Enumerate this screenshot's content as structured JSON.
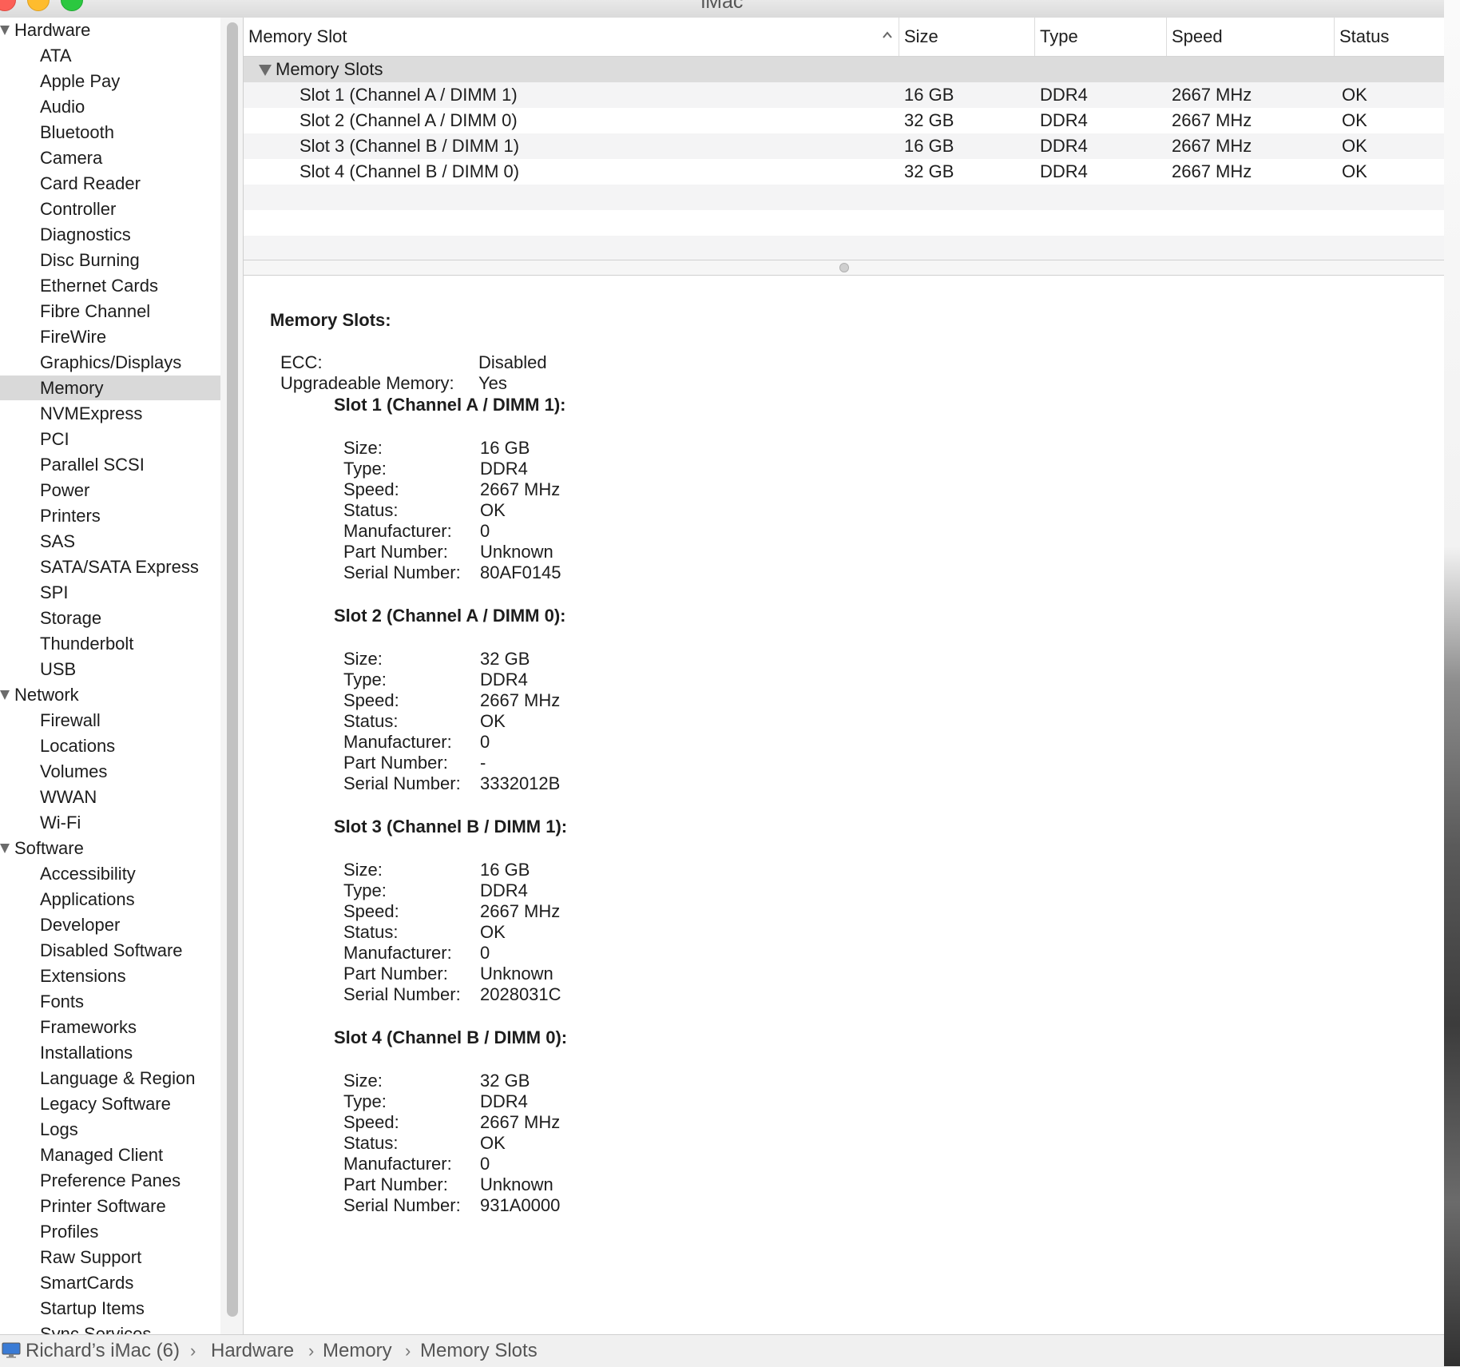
{
  "window": {
    "title": "iMac"
  },
  "sidebar": {
    "groups": [
      {
        "label": "Hardware",
        "items": [
          "ATA",
          "Apple Pay",
          "Audio",
          "Bluetooth",
          "Camera",
          "Card Reader",
          "Controller",
          "Diagnostics",
          "Disc Burning",
          "Ethernet Cards",
          "Fibre Channel",
          "FireWire",
          "Graphics/Displays",
          "Memory",
          "NVMExpress",
          "PCI",
          "Parallel SCSI",
          "Power",
          "Printers",
          "SAS",
          "SATA/SATA Express",
          "SPI",
          "Storage",
          "Thunderbolt",
          "USB"
        ]
      },
      {
        "label": "Network",
        "items": [
          "Firewall",
          "Locations",
          "Volumes",
          "WWAN",
          "Wi-Fi"
        ]
      },
      {
        "label": "Software",
        "items": [
          "Accessibility",
          "Applications",
          "Developer",
          "Disabled Software",
          "Extensions",
          "Fonts",
          "Frameworks",
          "Installations",
          "Language & Region",
          "Legacy Software",
          "Logs",
          "Managed Client",
          "Preference Panes",
          "Printer Software",
          "Profiles",
          "Raw Support",
          "SmartCards",
          "Startup Items",
          "Sync Services"
        ]
      }
    ],
    "selected": "Memory"
  },
  "table": {
    "columns": [
      "Memory Slot",
      "Size",
      "Type",
      "Speed",
      "Status"
    ],
    "group_label": "Memory Slots",
    "rows": [
      [
        "Slot 1 (Channel A / DIMM 1)",
        "16 GB",
        "DDR4",
        "2667 MHz",
        "OK"
      ],
      [
        "Slot 2 (Channel A / DIMM 0)",
        "32 GB",
        "DDR4",
        "2667 MHz",
        "OK"
      ],
      [
        "Slot 3 (Channel B / DIMM 1)",
        "16 GB",
        "DDR4",
        "2667 MHz",
        "OK"
      ],
      [
        "Slot 4 (Channel B / DIMM 0)",
        "32 GB",
        "DDR4",
        "2667 MHz",
        "OK"
      ]
    ]
  },
  "detail": {
    "title": "Memory Slots:",
    "summary": [
      {
        "key": "ECC:",
        "value": "Disabled"
      },
      {
        "key": "Upgradeable Memory:",
        "value": "Yes"
      }
    ],
    "slots": [
      {
        "title": "Slot 1 (Channel A / DIMM 1):",
        "fields": [
          [
            "Size:",
            "16 GB"
          ],
          [
            "Type:",
            "DDR4"
          ],
          [
            "Speed:",
            "2667 MHz"
          ],
          [
            "Status:",
            "OK"
          ],
          [
            "Manufacturer:",
            "0"
          ],
          [
            "Part Number:",
            "Unknown"
          ],
          [
            "Serial Number:",
            "80AF0145"
          ]
        ]
      },
      {
        "title": "Slot 2 (Channel A / DIMM 0):",
        "fields": [
          [
            "Size:",
            "32 GB"
          ],
          [
            "Type:",
            "DDR4"
          ],
          [
            "Speed:",
            "2667 MHz"
          ],
          [
            "Status:",
            "OK"
          ],
          [
            "Manufacturer:",
            "0"
          ],
          [
            "Part Number:",
            "-"
          ],
          [
            "Serial Number:",
            "3332012B"
          ]
        ]
      },
      {
        "title": "Slot 3 (Channel B / DIMM 1):",
        "fields": [
          [
            "Size:",
            "16 GB"
          ],
          [
            "Type:",
            "DDR4"
          ],
          [
            "Speed:",
            "2667 MHz"
          ],
          [
            "Status:",
            "OK"
          ],
          [
            "Manufacturer:",
            "0"
          ],
          [
            "Part Number:",
            "Unknown"
          ],
          [
            "Serial Number:",
            "2028031C"
          ]
        ]
      },
      {
        "title": "Slot 4 (Channel B / DIMM 0):",
        "fields": [
          [
            "Size:",
            "32 GB"
          ],
          [
            "Type:",
            "DDR4"
          ],
          [
            "Speed:",
            "2667 MHz"
          ],
          [
            "Status:",
            "OK"
          ],
          [
            "Manufacturer:",
            "0"
          ],
          [
            "Part Number:",
            "Unknown"
          ],
          [
            "Serial Number:",
            "931A0000"
          ]
        ]
      }
    ]
  },
  "pathbar": {
    "segments": [
      "Richard’s iMac (6)",
      "Hardware",
      "Memory",
      "Memory Slots"
    ],
    "separator": "›"
  },
  "icons": {
    "computer": "imac-icon",
    "sort": "chevron-up-icon",
    "disclosure": "disclosure-triangle-icon"
  }
}
